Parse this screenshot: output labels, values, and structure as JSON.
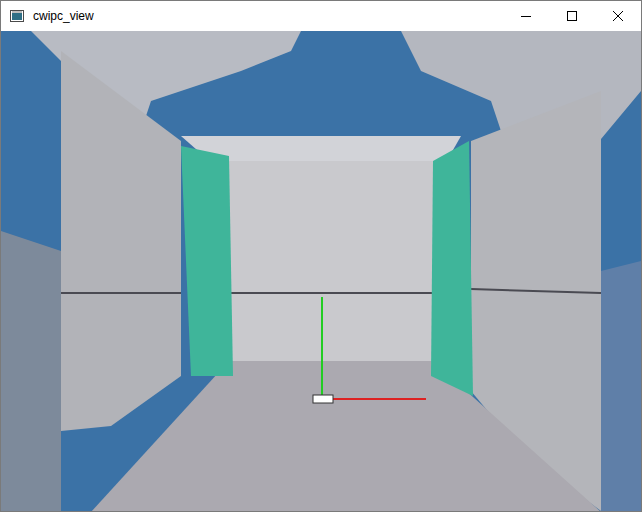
{
  "window": {
    "title": "cwipc_view"
  }
}
